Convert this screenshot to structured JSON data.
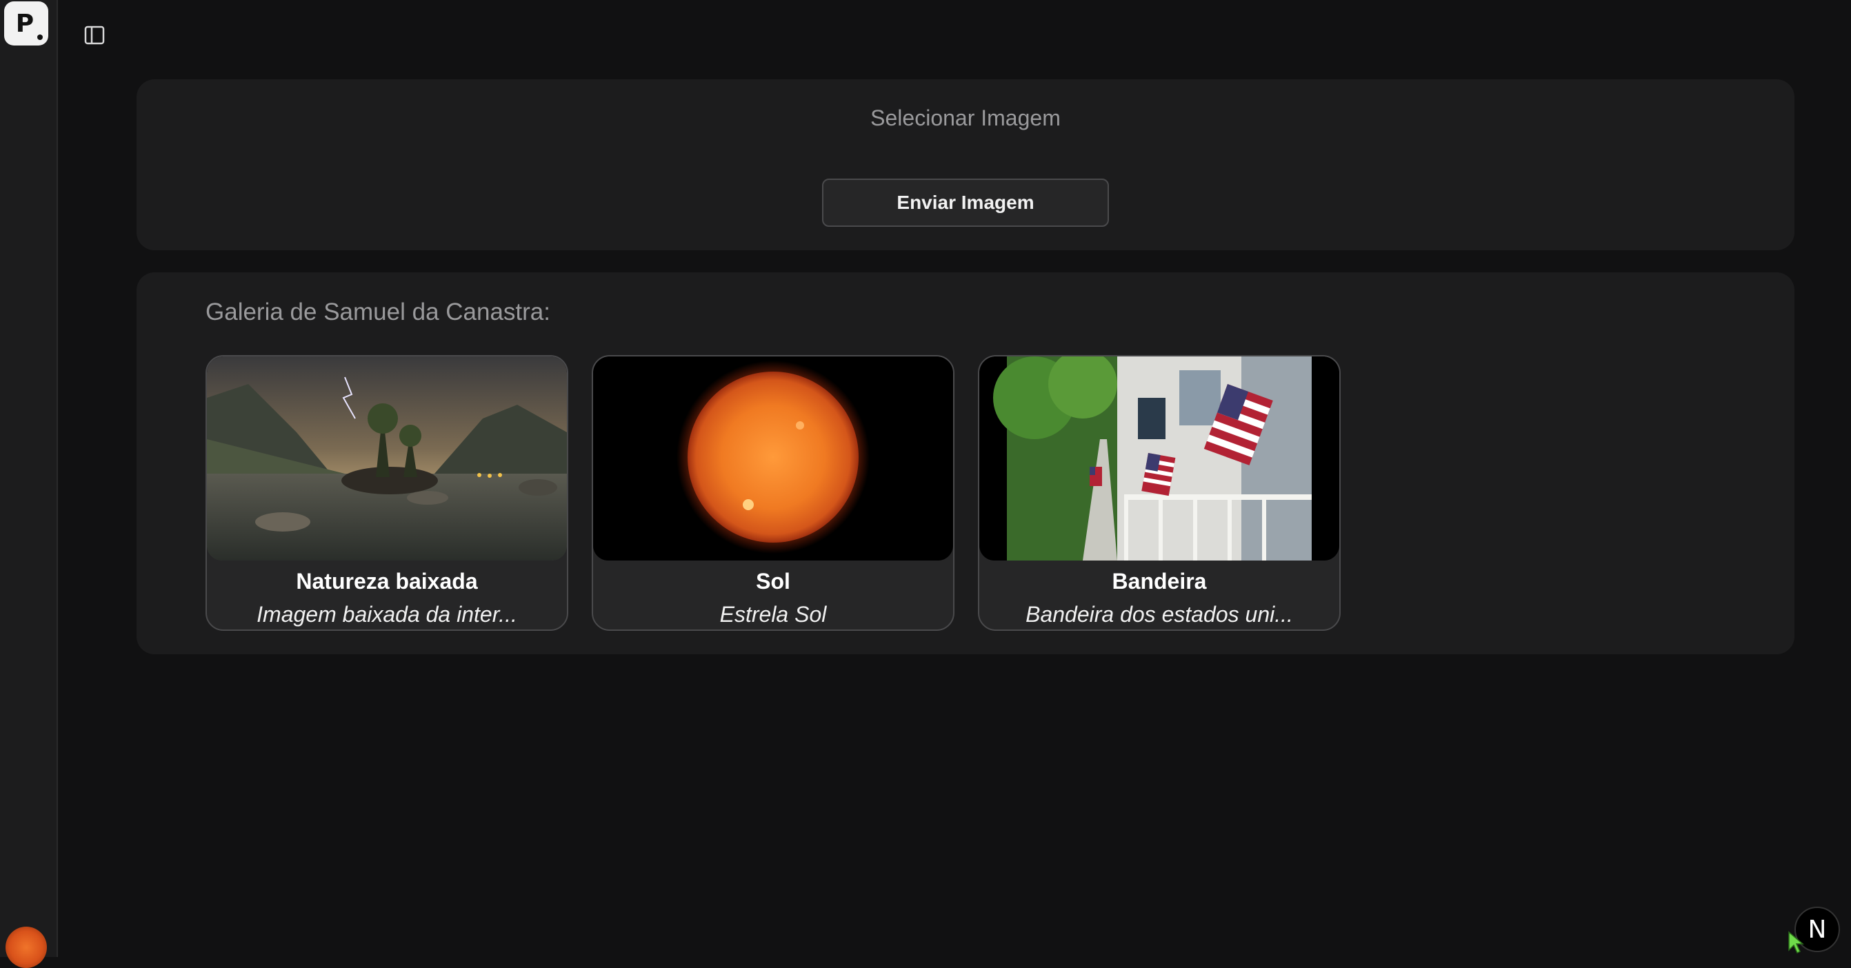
{
  "app": {
    "logo_letter": "P",
    "sidebar_toggle_icon": "sidebar-toggle-icon"
  },
  "upload": {
    "title": "Selecionar Imagem",
    "button_label": "Enviar Imagem"
  },
  "gallery": {
    "title": "Galeria de Samuel da Canastra:",
    "items": [
      {
        "name": "Natureza baixada",
        "description": "Imagem baixada da inter..."
      },
      {
        "name": "Sol",
        "description": "Estrela Sol"
      },
      {
        "name": "Bandeira",
        "description": "Bandeira dos estados uni..."
      }
    ]
  },
  "corner_badge": {
    "letter": "N"
  },
  "colors": {
    "background": "#111112",
    "card": "#1c1c1d",
    "tile": "#262627",
    "border": "#4a4a4c",
    "muted_text": "#9a9a9c"
  }
}
